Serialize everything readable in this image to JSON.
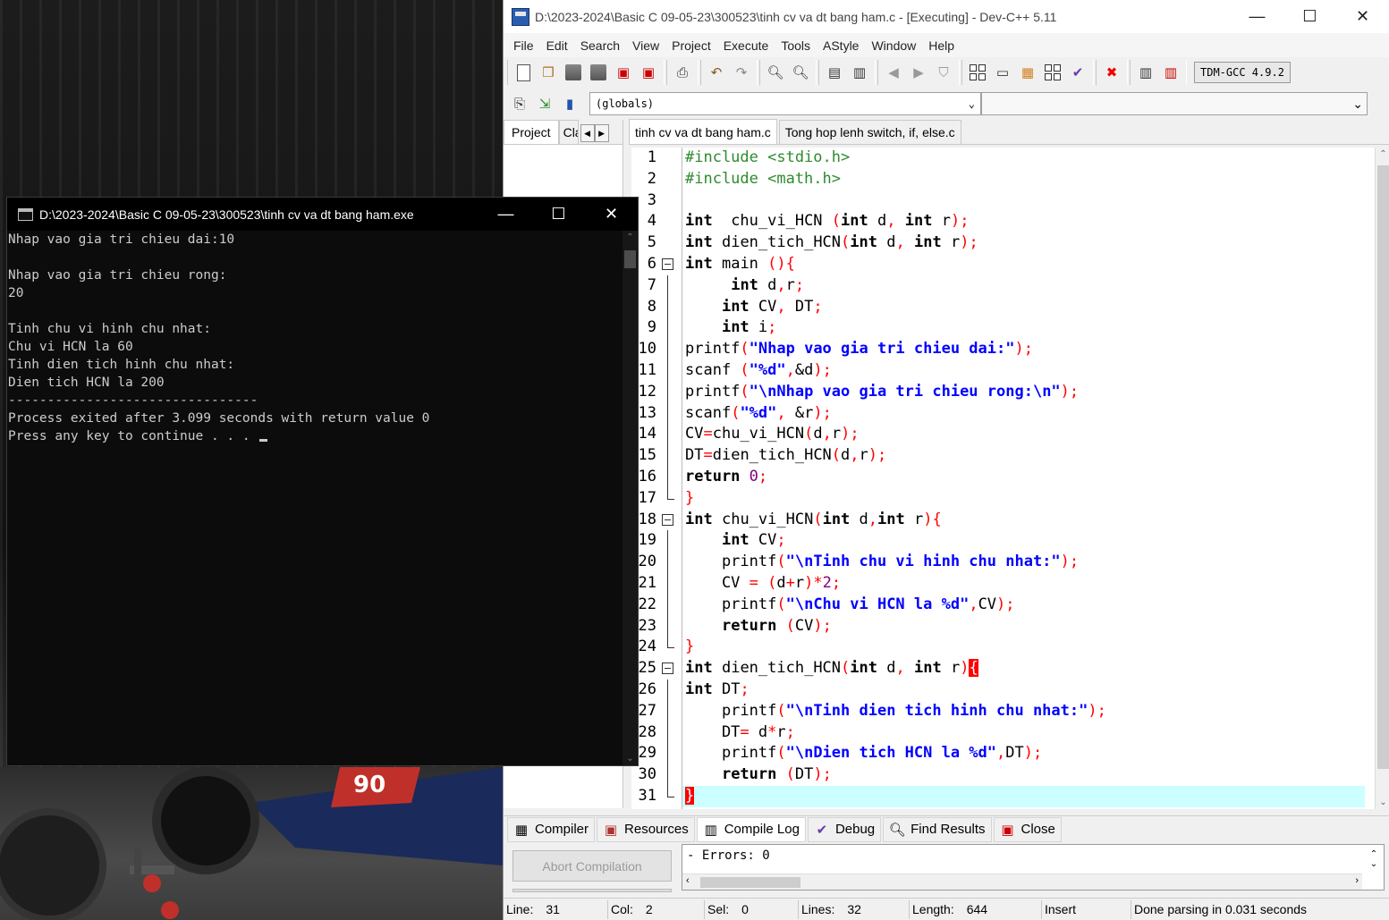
{
  "ide": {
    "title": "D:\\2023-2024\\Basic C 09-05-23\\300523\\tinh cv va dt bang ham.c - [Executing] - Dev-C++ 5.11",
    "menu": [
      "File",
      "Edit",
      "Search",
      "View",
      "Project",
      "Execute",
      "Tools",
      "AStyle",
      "Window",
      "Help"
    ],
    "compiler": "TDM-GCC 4.9.2",
    "scope": "(globals)",
    "project_tabs": [
      "Project",
      "Cla"
    ],
    "editor_tabs": [
      "tinh cv va dt bang ham.c",
      "Tong hop lenh switch, if, else.c"
    ],
    "bottom_tabs": [
      "Compiler",
      "Resources",
      "Compile Log",
      "Debug",
      "Find Results",
      "Close"
    ],
    "abort_button": "Abort Compilation",
    "log_text": "- Errors: 0",
    "status": {
      "line_label": "Line:",
      "line_value": "31",
      "col_label": "Col:",
      "col_value": "2",
      "sel_label": "Sel:",
      "sel_value": "0",
      "lines_label": "Lines:",
      "lines_value": "32",
      "length_label": "Length:",
      "length_value": "644",
      "mode": "Insert",
      "parse": "Done parsing in 0.031 seconds"
    }
  },
  "code": [
    [
      [
        "pp",
        "#include <stdio.h>"
      ]
    ],
    [
      [
        "pp",
        "#include <math.h>"
      ]
    ],
    [],
    [
      [
        "kw",
        "int"
      ],
      [
        "",
        "  chu_vi_HCN "
      ],
      [
        "sym",
        "("
      ],
      [
        "kw",
        "int"
      ],
      [
        "",
        "",
        " "
      ],
      [
        "",
        "d"
      ],
      [
        "sym",
        ","
      ],
      [
        "",
        "",
        " "
      ],
      [
        "kw",
        "int"
      ],
      [
        "",
        "",
        " "
      ],
      [
        "",
        "r"
      ],
      [
        "sym",
        ");"
      ]
    ],
    [
      [
        "kw",
        "int"
      ],
      [
        "",
        "",
        " "
      ],
      [
        "",
        "dien_tich_HCN"
      ],
      [
        "sym",
        "("
      ],
      [
        "kw",
        "int"
      ],
      [
        "",
        "",
        " "
      ],
      [
        "",
        "d"
      ],
      [
        "sym",
        ","
      ],
      [
        "",
        "",
        " "
      ],
      [
        "kw",
        "int"
      ],
      [
        "",
        "",
        " "
      ],
      [
        "",
        "r"
      ],
      [
        "sym",
        ");"
      ]
    ],
    [
      [
        "kw",
        "int"
      ],
      [
        "",
        "",
        " "
      ],
      [
        "",
        "main "
      ],
      [
        "sym",
        "(){"
      ]
    ],
    [
      [
        "",
        "",
        " "
      ],
      [
        "",
        "    "
      ],
      [
        "kw",
        "int"
      ],
      [
        "",
        "",
        " "
      ],
      [
        "",
        "d"
      ],
      [
        "sym",
        ","
      ],
      [
        "",
        "r"
      ],
      [
        "sym",
        ";"
      ]
    ],
    [
      [
        "",
        "    "
      ],
      [
        "kw",
        "int"
      ],
      [
        "",
        "",
        " "
      ],
      [
        "",
        "CV"
      ],
      [
        "sym",
        ","
      ],
      [
        "",
        "",
        " "
      ],
      [
        "",
        "DT"
      ],
      [
        "sym",
        ";"
      ]
    ],
    [
      [
        "",
        "    "
      ],
      [
        "kw",
        "int"
      ],
      [
        "",
        "",
        " "
      ],
      [
        "",
        "i"
      ],
      [
        "sym",
        ";"
      ]
    ],
    [
      [
        "",
        "printf"
      ],
      [
        "sym",
        "("
      ],
      [
        "str",
        "\"Nhap vao gia tri chieu dai:\""
      ],
      [
        "sym",
        ");"
      ]
    ],
    [
      [
        "",
        "scanf "
      ],
      [
        "sym",
        "("
      ],
      [
        "str",
        "\"%d\""
      ],
      [
        "sym",
        ","
      ],
      [
        "",
        "&d"
      ],
      [
        "sym",
        ");"
      ]
    ],
    [
      [
        "",
        "printf"
      ],
      [
        "sym",
        "("
      ],
      [
        "str",
        "\"\\nNhap vao gia tri chieu rong:\\n\""
      ],
      [
        "sym",
        ");"
      ]
    ],
    [
      [
        "",
        "scanf"
      ],
      [
        "sym",
        "("
      ],
      [
        "str",
        "\"%d\""
      ],
      [
        "sym",
        ","
      ],
      [
        "",
        "",
        " "
      ],
      [
        "",
        "&r"
      ],
      [
        "sym",
        ");"
      ]
    ],
    [
      [
        "",
        "CV"
      ],
      [
        "sym",
        "="
      ],
      [
        "",
        "chu_vi_HCN"
      ],
      [
        "sym",
        "("
      ],
      [
        "",
        "d"
      ],
      [
        "sym",
        ","
      ],
      [
        "",
        "r"
      ],
      [
        "sym",
        ");"
      ]
    ],
    [
      [
        "",
        "DT"
      ],
      [
        "sym",
        "="
      ],
      [
        "",
        "dien_tich_HCN"
      ],
      [
        "sym",
        "("
      ],
      [
        "",
        "d"
      ],
      [
        "sym",
        ","
      ],
      [
        "",
        "r"
      ],
      [
        "sym",
        ");"
      ]
    ],
    [
      [
        "kw",
        "return"
      ],
      [
        "",
        "",
        " "
      ],
      [
        "num",
        "0"
      ],
      [
        "sym",
        ";"
      ]
    ],
    [
      [
        "sym",
        "}"
      ]
    ],
    [
      [
        "kw",
        "int"
      ],
      [
        "",
        "",
        " "
      ],
      [
        "",
        "chu_vi_HCN"
      ],
      [
        "sym",
        "("
      ],
      [
        "kw",
        "int"
      ],
      [
        "",
        "",
        " "
      ],
      [
        "",
        "d"
      ],
      [
        "sym",
        ","
      ],
      [
        "kw",
        "int"
      ],
      [
        "",
        "",
        " "
      ],
      [
        "",
        "r"
      ],
      [
        "sym",
        "){"
      ]
    ],
    [
      [
        "",
        "    "
      ],
      [
        "kw",
        "int"
      ],
      [
        "",
        "",
        " "
      ],
      [
        "",
        "CV"
      ],
      [
        "sym",
        ";"
      ]
    ],
    [
      [
        "",
        "    printf"
      ],
      [
        "sym",
        "("
      ],
      [
        "str",
        "\"\\nTinh chu vi hinh chu nhat:\""
      ],
      [
        "sym",
        ");"
      ]
    ],
    [
      [
        "",
        "    CV "
      ],
      [
        "sym",
        "="
      ],
      [
        "",
        "",
        " "
      ],
      [
        "sym",
        "("
      ],
      [
        "",
        "d"
      ],
      [
        "sym",
        "+"
      ],
      [
        "",
        "r"
      ],
      [
        "sym",
        ")*"
      ],
      [
        "num",
        "2"
      ],
      [
        "sym",
        ";"
      ]
    ],
    [
      [
        "",
        "    printf"
      ],
      [
        "sym",
        "("
      ],
      [
        "str",
        "\"\\nChu vi HCN la %d\""
      ],
      [
        "sym",
        ","
      ],
      [
        "",
        "CV"
      ],
      [
        "sym",
        ");"
      ]
    ],
    [
      [
        "",
        "    "
      ],
      [
        "kw",
        "return"
      ],
      [
        "",
        "",
        " "
      ],
      [
        "sym",
        "("
      ],
      [
        "",
        "CV"
      ],
      [
        "sym",
        ");"
      ]
    ],
    [
      [
        "sym",
        "}"
      ]
    ],
    [
      [
        "kw",
        "int"
      ],
      [
        "",
        "",
        " "
      ],
      [
        "",
        "dien_tich_HCN"
      ],
      [
        "sym",
        "("
      ],
      [
        "kw",
        "int"
      ],
      [
        "",
        "",
        " "
      ],
      [
        "",
        "d"
      ],
      [
        "sym",
        ","
      ],
      [
        "",
        "",
        " "
      ],
      [
        "kw",
        "int"
      ],
      [
        "",
        "",
        " "
      ],
      [
        "",
        "r"
      ],
      [
        "sym",
        ")"
      ],
      [
        "brk",
        "{"
      ]
    ],
    [
      [
        "kw",
        "int"
      ],
      [
        "",
        "",
        " "
      ],
      [
        "",
        "DT"
      ],
      [
        "sym",
        ";"
      ]
    ],
    [
      [
        "",
        "    printf"
      ],
      [
        "sym",
        "("
      ],
      [
        "str",
        "\"\\nTinh dien tich hinh chu nhat:\""
      ],
      [
        "sym",
        ");"
      ]
    ],
    [
      [
        "",
        "    DT"
      ],
      [
        "sym",
        "="
      ],
      [
        "",
        "",
        " "
      ],
      [
        "",
        "d"
      ],
      [
        "sym",
        "*"
      ],
      [
        "",
        "r"
      ],
      [
        "sym",
        ";"
      ]
    ],
    [
      [
        "",
        "    printf"
      ],
      [
        "sym",
        "("
      ],
      [
        "str",
        "\"\\nDien tich HCN la %d\""
      ],
      [
        "sym",
        ","
      ],
      [
        "",
        "DT"
      ],
      [
        "sym",
        ");"
      ]
    ],
    [
      [
        "",
        "    "
      ],
      [
        "kw",
        "return"
      ],
      [
        "",
        "",
        " "
      ],
      [
        "sym",
        "("
      ],
      [
        "",
        "DT"
      ],
      [
        "sym",
        ");"
      ]
    ],
    [
      [
        "brk",
        "}"
      ]
    ]
  ],
  "console": {
    "title": "D:\\2023-2024\\Basic C 09-05-23\\300523\\tinh cv va dt bang ham.exe",
    "lines": [
      "Nhap vao gia tri chieu dai:10",
      "",
      "Nhap vao gia tri chieu rong:",
      "20",
      "",
      "Tinh chu vi hinh chu nhat:",
      "Chu vi HCN la 60",
      "Tinh dien tich hinh chu nhat:",
      "Dien tich HCN la 200",
      "--------------------------------",
      "Process exited after 3.099 seconds with return value 0",
      "Press any key to continue . . . "
    ]
  }
}
